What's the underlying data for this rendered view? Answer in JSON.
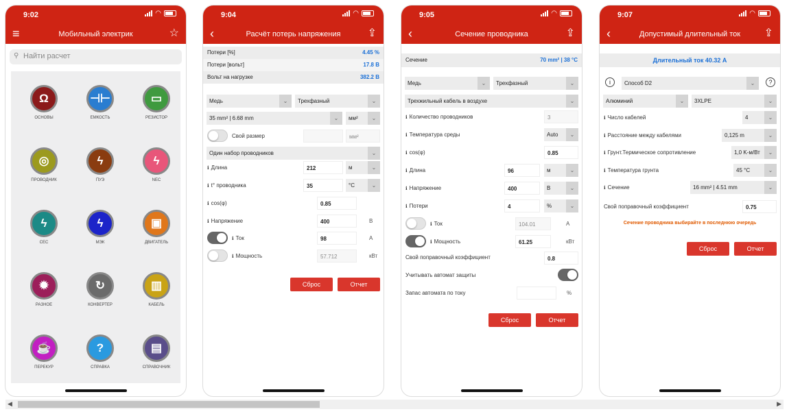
{
  "screens": [
    {
      "time": "9:02",
      "title": "Мобильный электрик",
      "search": "Найти расчет",
      "tiles": [
        {
          "label": "ОСНОВЫ",
          "icon": "omega-icon",
          "glyph": "Ω",
          "color": "#8b1a1a"
        },
        {
          "label": "ЕМКОСТЬ",
          "icon": "capacitor-icon",
          "glyph": "⊣⊢",
          "color": "#2a7dd0"
        },
        {
          "label": "РЕЗИСТОР",
          "icon": "resistor-icon",
          "glyph": "▭",
          "color": "#3f9a3f"
        },
        {
          "label": "ПРОВОДНИК",
          "icon": "conductor-icon",
          "glyph": "◎",
          "color": "#9c9a1e"
        },
        {
          "label": "ПУЭ",
          "icon": "lightning-icon",
          "glyph": "ϟ",
          "color": "#8a3c10"
        },
        {
          "label": "NEC",
          "icon": "lightning-icon",
          "glyph": "ϟ",
          "color": "#e8567a"
        },
        {
          "label": "CEC",
          "icon": "lightning-icon",
          "glyph": "ϟ",
          "color": "#1c8a86"
        },
        {
          "label": "МЭК",
          "icon": "lightning-icon",
          "glyph": "ϟ",
          "color": "#1c24c9"
        },
        {
          "label": "ДВИГАТЕЛЬ",
          "icon": "motor-icon",
          "glyph": "▣",
          "color": "#e0771b"
        },
        {
          "label": "РАЗНОЕ",
          "icon": "gear-icon",
          "glyph": "✹",
          "color": "#9c1f5a"
        },
        {
          "label": "КОНВЕРТЕР",
          "icon": "convert-icon",
          "glyph": "↻",
          "color": "#6b6b6b"
        },
        {
          "label": "КАБЕЛЬ",
          "icon": "cable-icon",
          "glyph": "▥",
          "color": "#c9a316"
        },
        {
          "label": "ПЕРЕКУР",
          "icon": "cup-icon",
          "glyph": "☕",
          "color": "#c21fc2"
        },
        {
          "label": "СПРАВКА",
          "icon": "question-icon",
          "glyph": "?",
          "color": "#2a9ae0"
        },
        {
          "label": "СПРАВОЧНИК",
          "icon": "book-icon",
          "glyph": "▤",
          "color": "#5a4d8a"
        }
      ]
    },
    {
      "time": "9:04",
      "title": "Расчёт потерь напряжения",
      "summary": [
        {
          "l": "Потери [%]",
          "v": "4.45 %"
        },
        {
          "l": "Потери [вольт]",
          "v": "17.8 В"
        },
        {
          "l": "Вольт на нагрузке",
          "v": "382.2 В"
        }
      ],
      "sel_material": "Медь",
      "sel_phase": "Трехфазный",
      "sel_size": "35 mm² | 6.68 mm",
      "sel_size_unit": "мм²",
      "own_size": "Свой размер",
      "own_unit": "мм²",
      "set": "Один набор проводников",
      "rows": [
        {
          "l": "Длина",
          "v": "212",
          "u": "м"
        },
        {
          "l": "t° проводника",
          "v": "35",
          "u": "°C"
        },
        {
          "l": "cos(φ)",
          "v": "0.85"
        },
        {
          "l": "Напряжение",
          "v": "400",
          "u": "В"
        },
        {
          "l": "Ток",
          "v": "98",
          "u": "А"
        },
        {
          "l": "Мощность",
          "v": "57.712",
          "u": "кВт"
        }
      ],
      "reset": "Сброс",
      "report": "Отчет"
    },
    {
      "time": "9:05",
      "title": "Сечение проводника",
      "sum_l": "Сечение",
      "sum_v": "70 mm² | 38 °C",
      "sel_material": "Медь",
      "sel_phase": "Трехфазный",
      "sel_cable": "Трехжильный кабель в воздухе",
      "rows": [
        {
          "l": "Количество проводников",
          "v": "3"
        },
        {
          "l": "Температура среды",
          "v": "Auto"
        },
        {
          "l": "cos(φ)",
          "v": "0.85"
        },
        {
          "l": "Длина",
          "v": "96",
          "u": "м"
        },
        {
          "l": "Напряжение",
          "v": "400",
          "u": "В"
        },
        {
          "l": "Потери",
          "v": "4",
          "u": "%"
        },
        {
          "l": "Ток",
          "v": "104.01",
          "u": "А"
        },
        {
          "l": "Мощность",
          "v": "61.25",
          "u": "кВт"
        }
      ],
      "own_coef": "Свой поправочный коэффициент",
      "own_coef_v": "0.8",
      "auto": "Учитывать автомат защиты",
      "reserve": "Запас автомата по току",
      "reserve_u": "%",
      "reset": "Сброс",
      "report": "Отчет"
    },
    {
      "time": "9:07",
      "title": "Допустимый длительный ток",
      "sum": "Длительный ток 40.32 А",
      "method": "Способ D2",
      "material": "Алюминий",
      "insul": "3XLPE",
      "rows": [
        {
          "l": "Число кабелей",
          "v": "4"
        },
        {
          "l": "Расстояние между кабелями",
          "v": "0,125 m"
        },
        {
          "l": "Грунт.Термическое сопротивление",
          "v": "1,0 K-м/Вт"
        },
        {
          "l": "Температура грунта",
          "v": "45 °C"
        },
        {
          "l": "Сечение",
          "v": "16 mm² | 4.51 mm"
        }
      ],
      "own_coef": "Свой поправочный коэффициент",
      "own_coef_v": "0.75",
      "note": "Сечение проводника выбирайте в последнюю очередь",
      "reset": "Сброс",
      "report": "Отчет"
    }
  ],
  "colors": {
    "header": "#cf2414",
    "button": "#d9362c",
    "value_blue": "#1a6fd6",
    "note": "#e05a00"
  }
}
